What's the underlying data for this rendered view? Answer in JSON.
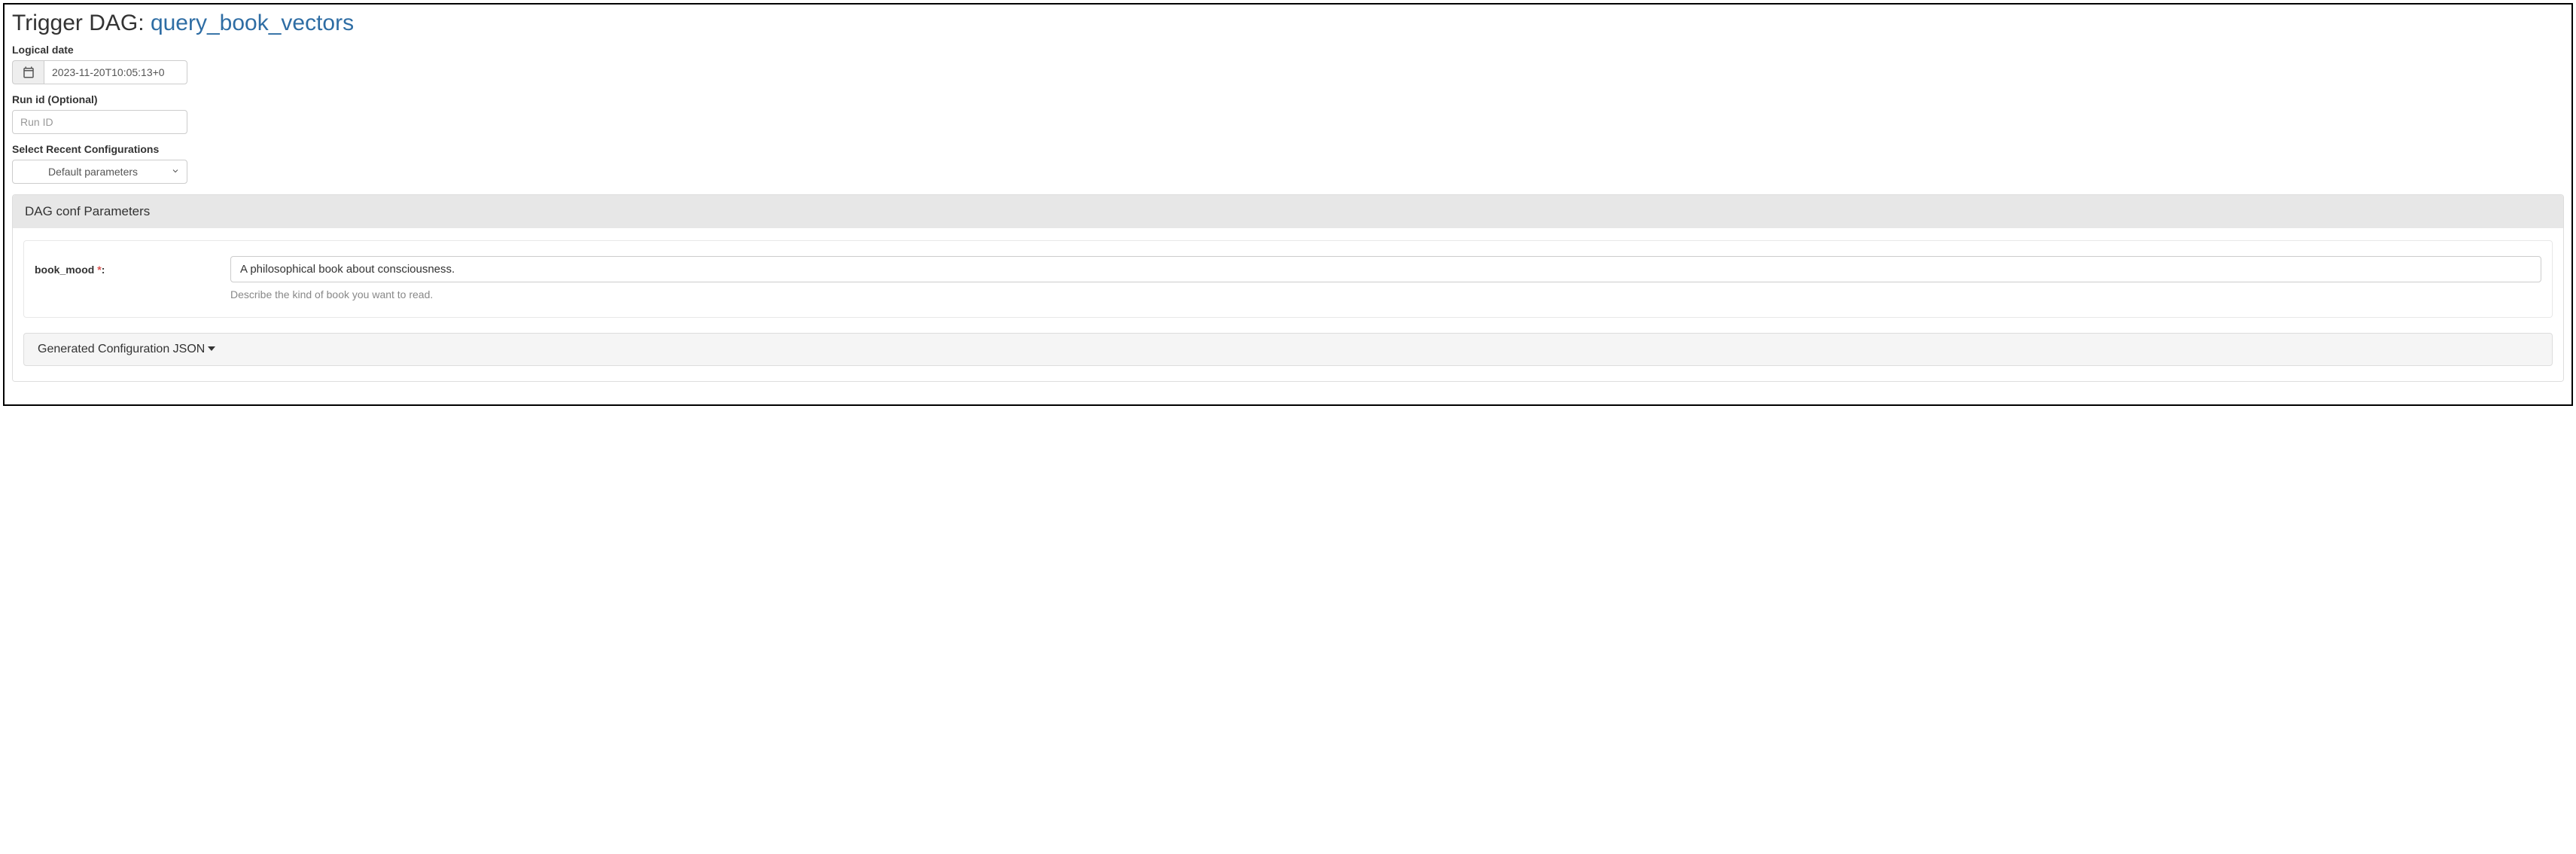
{
  "header": {
    "title_prefix": "Trigger DAG: ",
    "dag_name": "query_book_vectors"
  },
  "logical_date": {
    "label": "Logical date",
    "value": "2023-11-20T10:05:13+0"
  },
  "run_id": {
    "label": "Run id (Optional)",
    "placeholder": "Run ID",
    "value": ""
  },
  "recent_config": {
    "label": "Select Recent Configurations",
    "selected": "Default parameters"
  },
  "conf_panel": {
    "heading": "DAG conf Parameters",
    "params": [
      {
        "name": "book_mood",
        "label": "book_mood ",
        "required_marker": "*",
        "colon": ":",
        "value": "A philosophical book about consciousness.",
        "help": "Describe the kind of book you want to read."
      }
    ],
    "json_toggle_label": "Generated Configuration JSON"
  }
}
